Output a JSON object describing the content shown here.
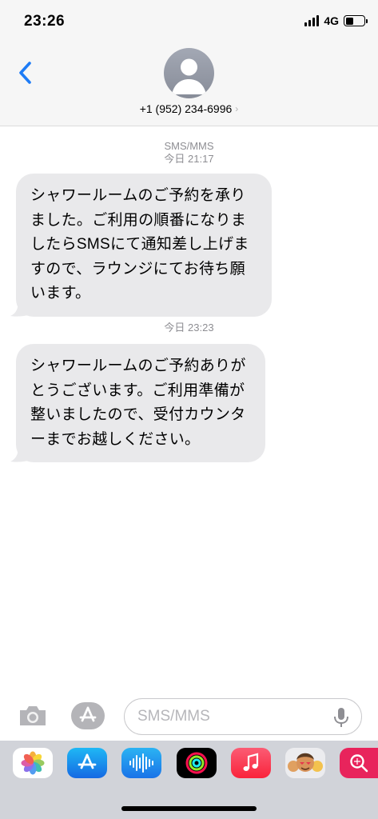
{
  "status_bar": {
    "time": "23:26",
    "network": "4G"
  },
  "header": {
    "contact": "+1 (952) 234-6996"
  },
  "thread": {
    "service": "SMS/MMS",
    "messages": [
      {
        "timestamp": "今日 21:17",
        "lines": [
          "シャワールームのご予約を承り",
          "ました。ご利用の順番になりま",
          "したらSMSにて通知差し上げま",
          "すので、ラウンジにてお待ち願",
          "います。"
        ]
      },
      {
        "timestamp": "今日 23:23",
        "lines": [
          "シャワールームのご予約ありが",
          "とうございます。ご利用準備が",
          "整いましたので、受付カウンタ",
          "ーまでお越しください。"
        ]
      }
    ]
  },
  "compose": {
    "placeholder": "SMS/MMS"
  },
  "app_drawer": {
    "apps": [
      "photos-app",
      "app-store-app",
      "audio-messages-app",
      "activity-app",
      "music-app",
      "memoji-app",
      "search-images-app"
    ]
  },
  "colors": {
    "accent": "#1e7cf6",
    "bubble": "#e9e9eb",
    "meta_text": "#8e8e93"
  }
}
